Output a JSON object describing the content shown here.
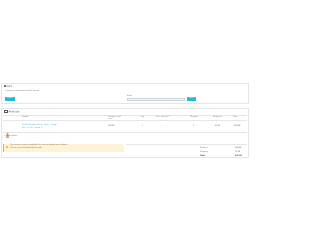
{
  "customer_panel": {
    "heading": "Cart",
    "subtitle": "Customer information will be shown",
    "button_left": "Search",
    "field_label": "Email",
    "button_right": "Search"
  },
  "cart_panel": {
    "heading": "Products",
    "columns": [
      "Product",
      "Unit price (tax excl.)",
      "Qty",
      "Price (tax incl.)",
      "Discount",
      "Reduction",
      "Total"
    ],
    "row": {
      "name_line1": "Printed Summer Dress - Color : Orange",
      "name_line2": "Size : S - Ref : demo_5",
      "unit_price": "$28.98",
      "qty": "1",
      "price_incl": "-",
      "discount": "0",
      "reduction": "$0.00",
      "total": "$28.98"
    },
    "add_voucher": "Add voucher",
    "warning_line1": "The customer cannot be modified if the cart has already been validated",
    "warning_line2": "This cart is not associated with an order",
    "totals": [
      {
        "label": "Products",
        "value": "$28.98"
      },
      {
        "label": "Shipping",
        "value": "$7.00"
      },
      {
        "label": "Total",
        "value": "$35.98"
      }
    ]
  },
  "colors": {
    "accent": "#25b9d7",
    "warning_bg": "#fff3d7",
    "border": "#e5e5e5"
  }
}
